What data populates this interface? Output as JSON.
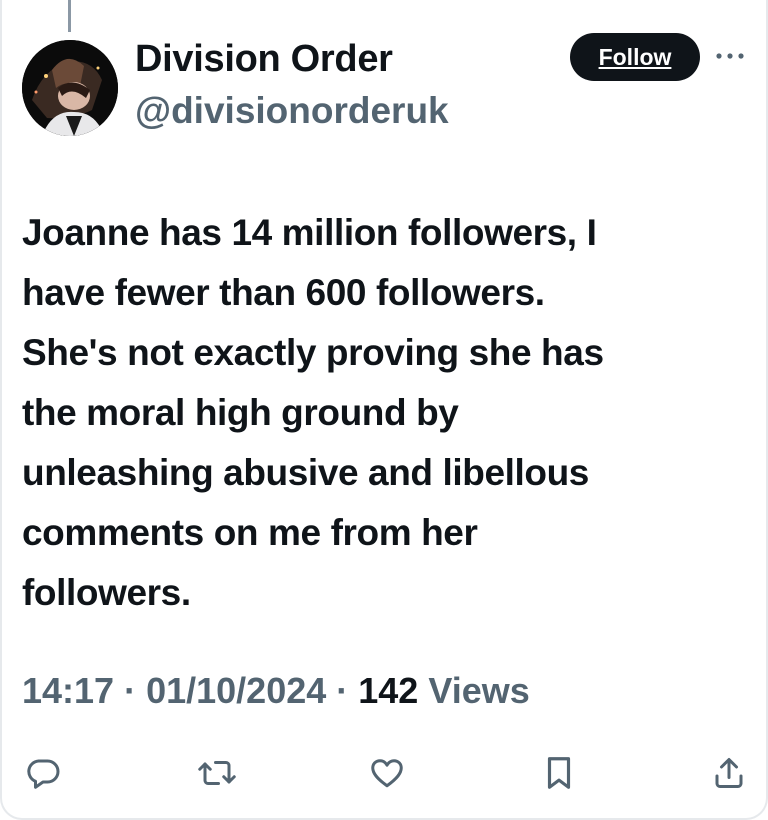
{
  "author": {
    "display_name": "Division Order",
    "handle": "@divisionorderuk"
  },
  "header": {
    "follow_label": "Follow",
    "more_icon": "more-horizontal-icon"
  },
  "tweet": {
    "lines": [
      "Joanne has 14 million followers, I",
      "have fewer than 600 followers.",
      "She's not exactly proving she has",
      "the moral high ground by",
      "unleashing abusive and libellous",
      "comments on me from her",
      "followers."
    ]
  },
  "meta": {
    "time": "14:17",
    "separator": " · ",
    "date": "01/10/2024",
    "views_count": "142",
    "views_label": " Views"
  },
  "actions": [
    {
      "icon": "reply-icon"
    },
    {
      "icon": "retweet-icon"
    },
    {
      "icon": "like-icon"
    },
    {
      "icon": "bookmark-icon"
    },
    {
      "icon": "share-icon"
    }
  ],
  "colors": {
    "text": "#0f1419",
    "secondary": "#536471",
    "button_bg": "#0f1419",
    "button_text": "#ffffff",
    "border": "#e6e9ec"
  }
}
